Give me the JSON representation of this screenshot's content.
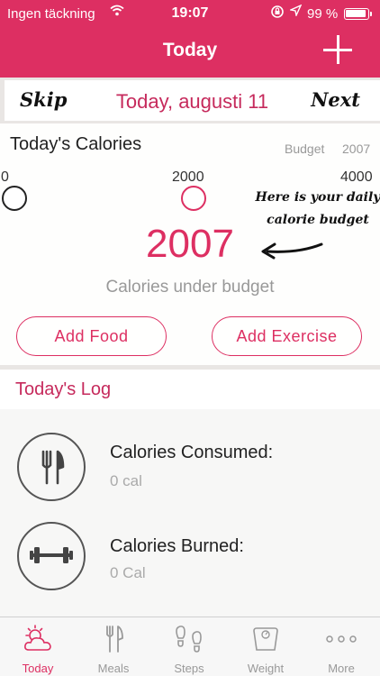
{
  "status_bar": {
    "carrier": "Ingen täckning",
    "time": "19:07",
    "battery": "99 %",
    "icons": [
      "wifi-icon",
      "rotation-lock-icon",
      "location-icon",
      "battery-icon"
    ]
  },
  "header": {
    "title": "Today",
    "add_icon": "plus-icon",
    "color": "#dd2f62"
  },
  "date_nav": {
    "skip_label": "Skip",
    "date": "Today, augusti 11",
    "next_label": "Next"
  },
  "calories": {
    "title": "Today's Calories",
    "budget_label": "Budget",
    "budget_value": "2007",
    "scale": [
      "0",
      "2000",
      "4000"
    ],
    "annotation": "Here is your daily calorie budget",
    "remaining": "2007",
    "remaining_label": "Calories under budget",
    "add_food_label": "Add Food",
    "add_exercise_label": "Add Exercise"
  },
  "log": {
    "title": "Today's Log",
    "consumed_label": "Calories Consumed:",
    "consumed_value": "0 cal",
    "burned_label": "Calories Burned:",
    "burned_value": "0 Cal"
  },
  "tabs": [
    {
      "label": "Today",
      "icon": "sun-cloud-icon",
      "active": true
    },
    {
      "label": "Meals",
      "icon": "fork-knife-icon",
      "active": false
    },
    {
      "label": "Steps",
      "icon": "footprints-icon",
      "active": false
    },
    {
      "label": "Weight",
      "icon": "scale-icon",
      "active": false
    },
    {
      "label": "More",
      "icon": "more-dots-icon",
      "active": false
    }
  ],
  "accent_color": "#dd2f62"
}
